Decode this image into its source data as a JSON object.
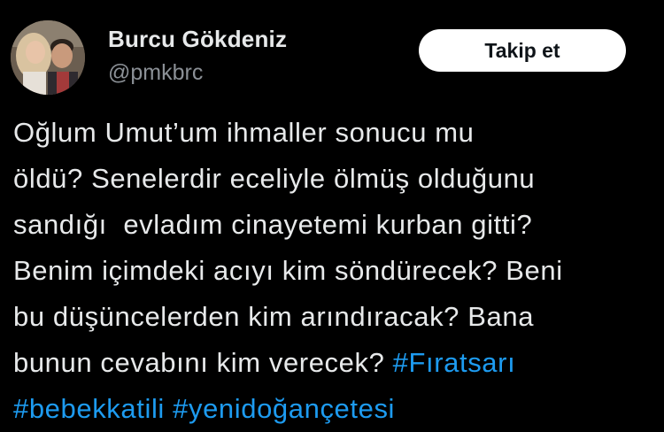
{
  "author": {
    "name": "Burcu Gökdeniz",
    "handle": "@pmkbrc"
  },
  "follow_button": {
    "label": "Takip et"
  },
  "tweet": {
    "lines": [
      "Oğlum Umut’um ihmaller sonucu mu",
      "öldü? Senelerdir eceliyle ölmüş olduğunu",
      "sandığı  evladım cinayetemi kurban gitti?",
      "Benim içimdeki acıyı kim söndürecek? Beni",
      "bu düşüncelerden kim arındıracak? Bana",
      "bunun cevabını kim verecek? "
    ],
    "hashtags": [
      "#Fıratsarı",
      "#bebekkatili",
      "#yenidoğançetesi"
    ]
  },
  "colors": {
    "background": "#000000",
    "text": "#e7e9ea",
    "secondary_text": "#8b9096",
    "hashtag": "#1d9bf0",
    "button_bg": "#ffffff",
    "button_text": "#0f1419"
  }
}
